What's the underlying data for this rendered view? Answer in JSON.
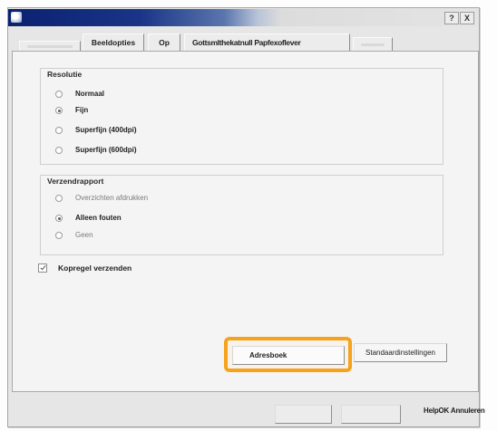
{
  "window": {
    "help_label": "?",
    "close_label": "X"
  },
  "tabs": [
    {
      "label": "Beeldopties"
    },
    {
      "label": "Op"
    },
    {
      "label": "Gottsmlthekatnull Papfexoflever"
    }
  ],
  "resolutie": {
    "title": "Resolutie",
    "options": [
      {
        "label": "Normaal",
        "checked": false
      },
      {
        "label": "Fijn",
        "checked": true
      },
      {
        "label": "Superfijn (400dpi)",
        "checked": false
      },
      {
        "label": "Superfijn (600dpi)",
        "checked": false
      }
    ]
  },
  "verzendrapport": {
    "title": "Verzendrapport",
    "options": [
      {
        "label": "Overzichten afdrukken",
        "checked": false,
        "disabled": true
      },
      {
        "label": "Alleen fouten",
        "checked": true,
        "disabled": false
      },
      {
        "label": "Geen",
        "checked": false,
        "disabled": true
      }
    ]
  },
  "kopregel": {
    "label": "Kopregel verzenden",
    "checked": true
  },
  "buttons": {
    "adresboek": "Adresboek",
    "standaard": "Standaardinstellingen"
  },
  "footer": {
    "overflow_text": "HelpOK Annuleren"
  },
  "colors": {
    "highlight": "#f7a21b",
    "titlebar": "#0b2170"
  }
}
